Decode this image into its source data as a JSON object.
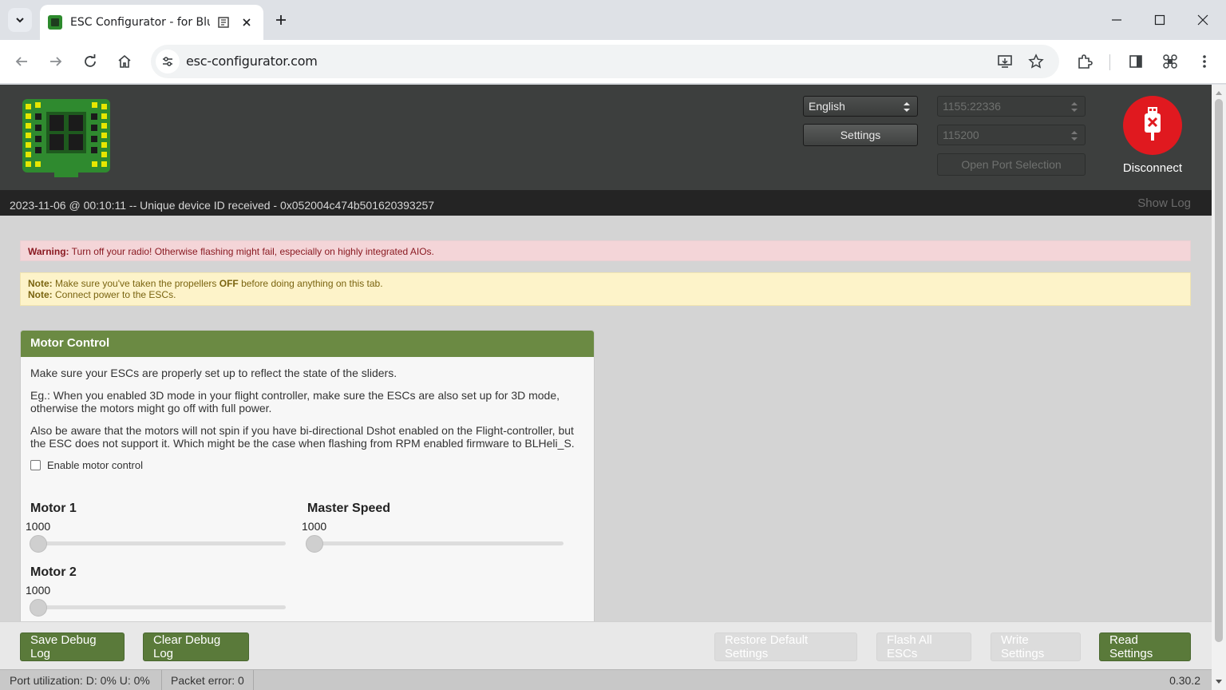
{
  "browser": {
    "tab_title": "ESC Configurator - for Blue",
    "url": "esc-configurator.com"
  },
  "header": {
    "language": "English",
    "settings_label": "Settings",
    "port": "1155:22336",
    "baud": "115200",
    "open_port_label": "Open Port Selection",
    "disconnect_label": "Disconnect"
  },
  "log": {
    "last_message": "2023-11-06 @ 00:10:11 -- Unique device ID received - 0x052004c474b501620393257",
    "show_log_label": "Show Log"
  },
  "warning": {
    "label": "Warning:",
    "text": " Turn off your radio! Otherwise flashing might fail, especially on highly integrated AIOs."
  },
  "notes": {
    "label": "Note:",
    "line1_pre": " Make sure you've taken the propellers ",
    "line1_bold": "OFF",
    "line1_post": " before doing anything on this tab.",
    "line2": " Connect power to the ESCs."
  },
  "motor_control": {
    "title": "Motor Control",
    "p1": "Make sure your ESCs are properly set up to reflect the state of the sliders.",
    "p2": "Eg.: When you enabled 3D mode in your flight controller, make sure the ESCs are also set up for 3D mode, otherwise the motors might go off with full power.",
    "p3": "Also be aware that the motors will not spin if you have bi-directional Dshot enabled on the Flight-controller, but the ESC does not support it. Which might be the case when flashing from RPM enabled firmware to BLHeli_S.",
    "enable_label": "Enable motor control",
    "motor1_label": "Motor 1",
    "motor1_value": "1000",
    "master_label": "Master Speed",
    "master_value": "1000",
    "motor2_label": "Motor 2",
    "motor2_value": "1000"
  },
  "actions": {
    "save_debug": "Save Debug Log",
    "clear_debug": "Clear Debug Log",
    "restore_defaults": "Restore Default Settings",
    "flash_all": "Flash All ESCs",
    "write_settings": "Write Settings",
    "read_settings": "Read Settings"
  },
  "status": {
    "port_util": "Port utilization: D: 0% U: 0%",
    "packet_error": "Packet error: 0",
    "version": "0.30.2"
  },
  "colors": {
    "header_bg": "#3d3f3e",
    "panel_header": "#6b8a43",
    "action_green": "#5a7a3a",
    "disconnect_red": "#e0191f"
  }
}
